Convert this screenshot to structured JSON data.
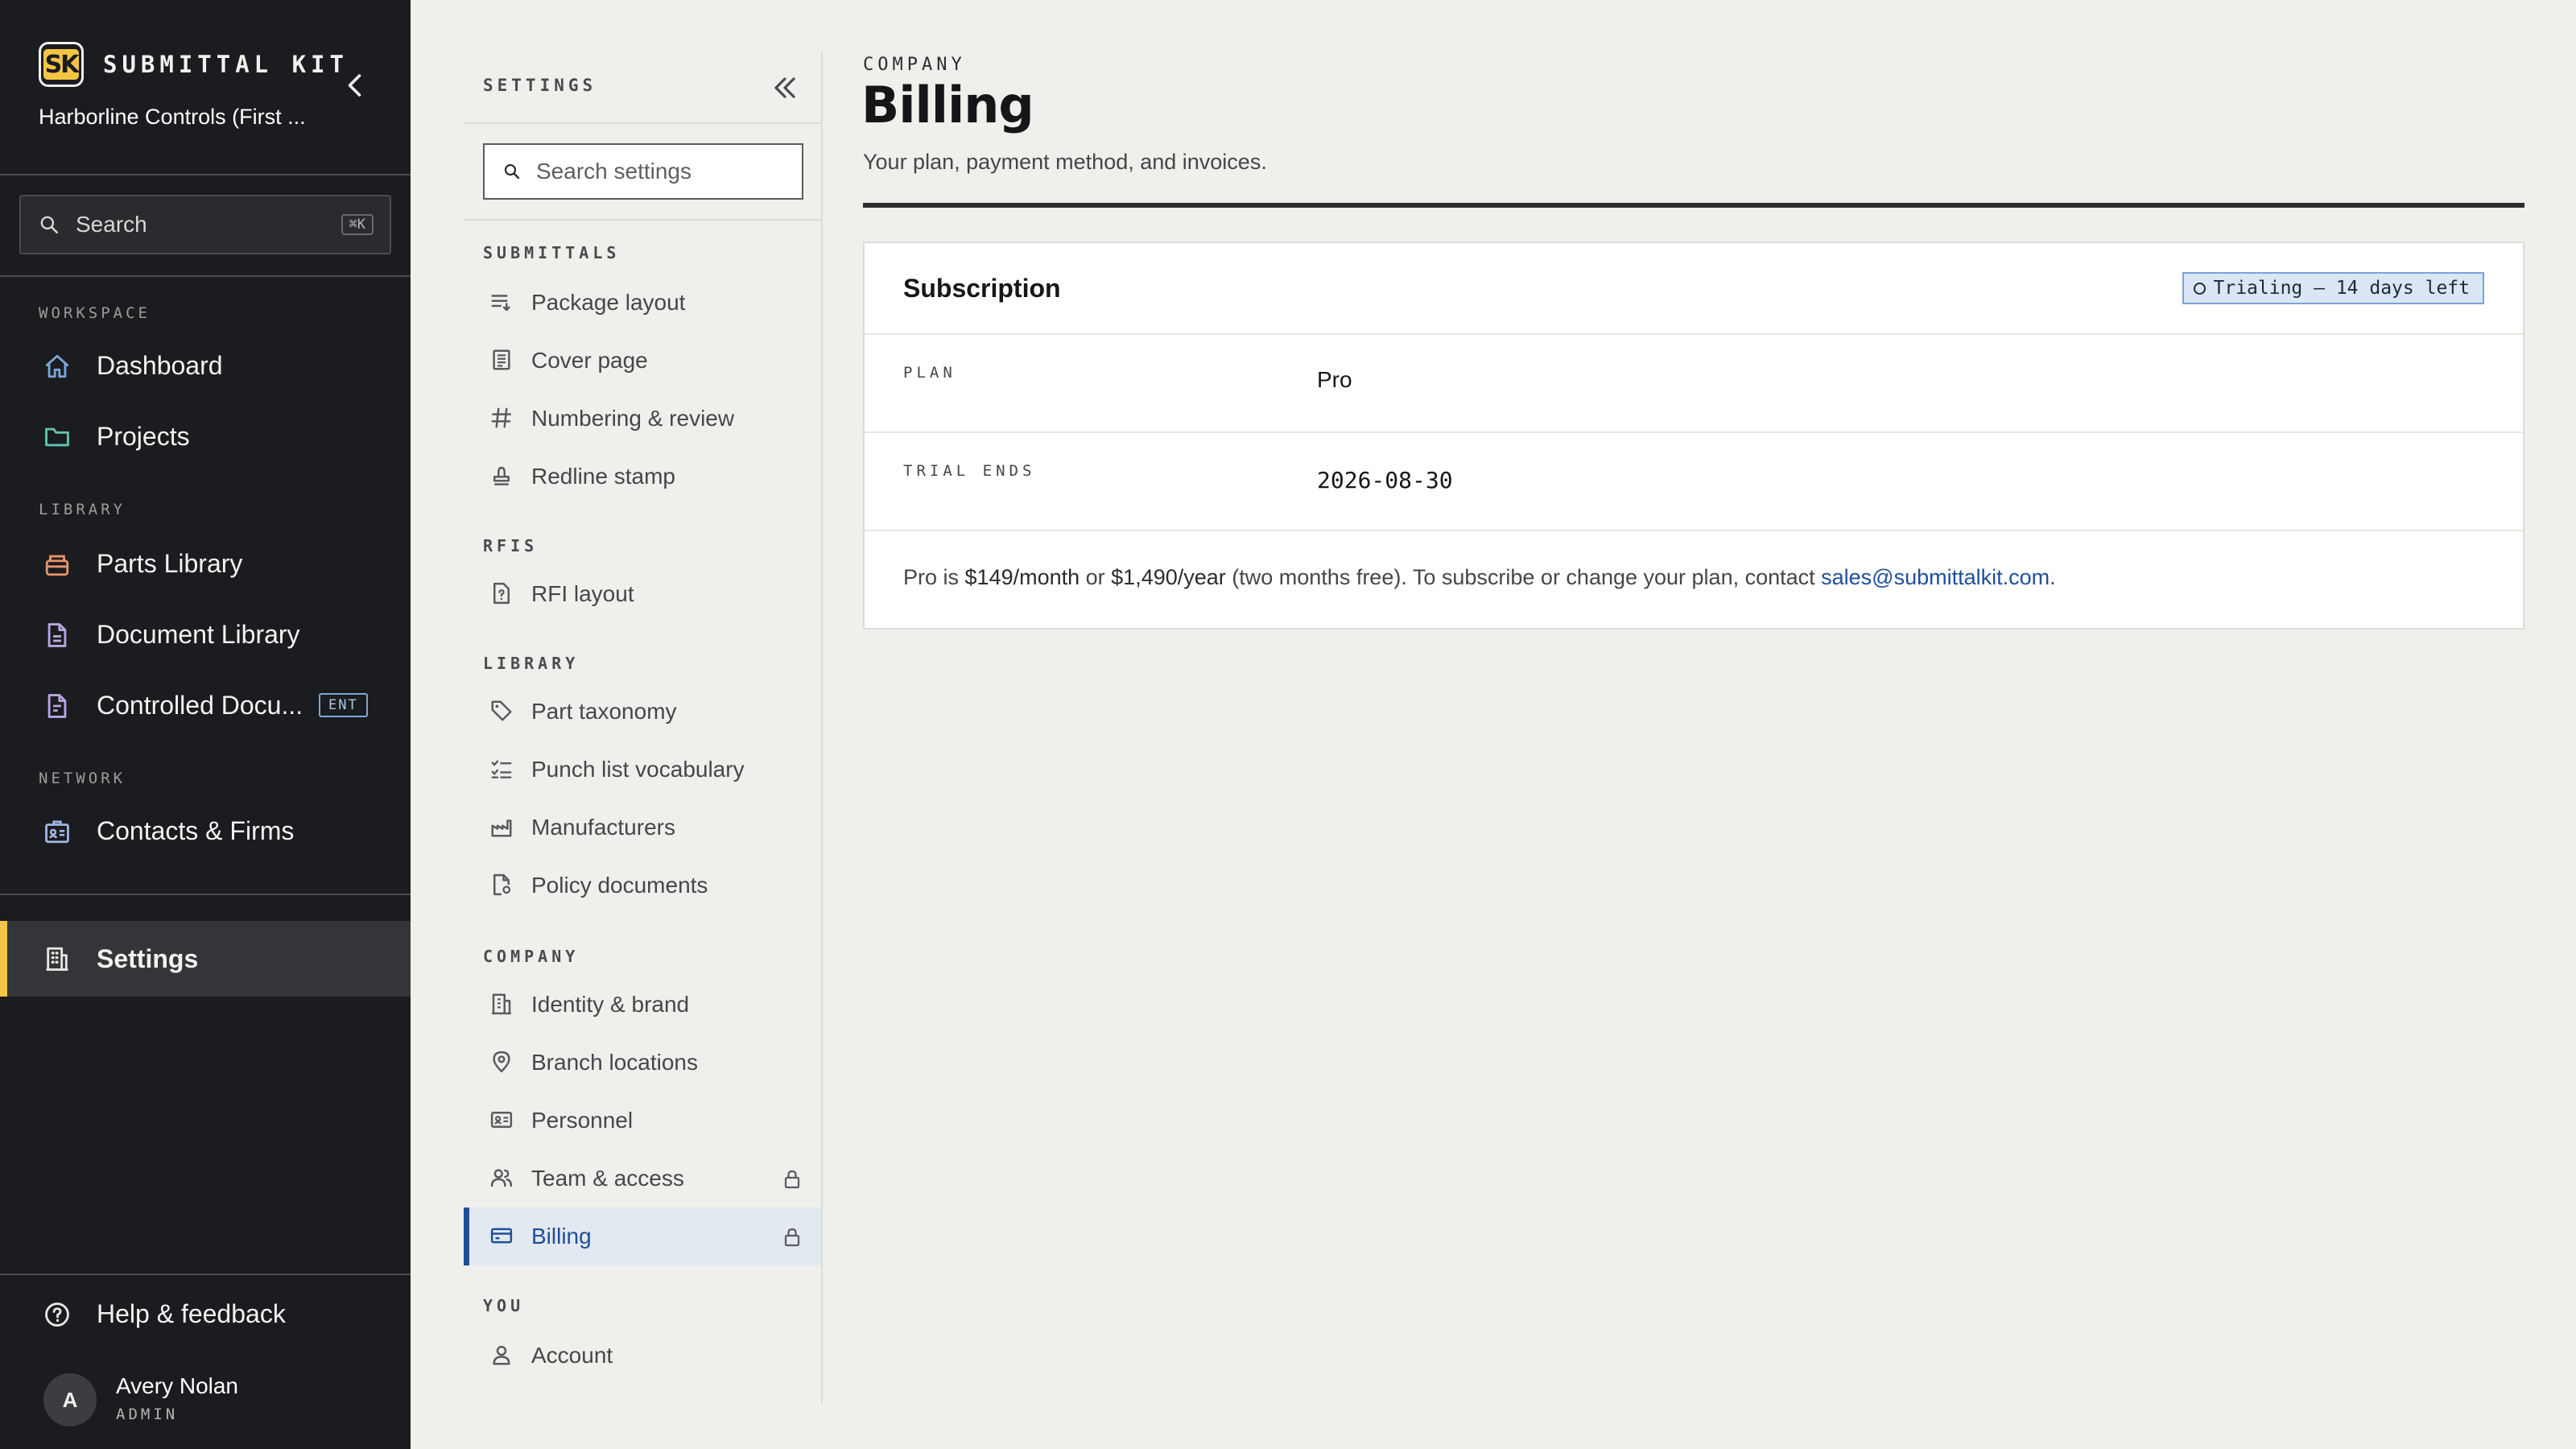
{
  "sidebar": {
    "logo_text": "SK",
    "brand": "SUBMITTAL KIT",
    "company": "Harborline Controls (First ...",
    "search": {
      "label": "Search",
      "shortcut": "⌘K"
    },
    "sections": {
      "workspace": "WORKSPACE",
      "library": "LIBRARY",
      "network": "NETWORK"
    },
    "items": {
      "dashboard": "Dashboard",
      "projects": "Projects",
      "parts_library": "Parts Library",
      "document_library": "Document Library",
      "controlled_docs": "Controlled Docu...",
      "controlled_docs_badge": "ENT",
      "contacts": "Contacts & Firms",
      "settings": "Settings",
      "help": "Help & feedback"
    },
    "user": {
      "initial": "A",
      "name": "Avery Nolan",
      "role": "ADMIN"
    },
    "icon_colors": {
      "dashboard": "#7aa7d8",
      "projects": "#5fc4b0",
      "parts": "#e8946a",
      "documents": "#b8a6e0",
      "contacts": "#9fb6e6",
      "accent": "#f4c542"
    }
  },
  "settings_nav": {
    "title": "SETTINGS",
    "search_placeholder": "Search settings",
    "sections": {
      "submittals": "SUBMITTALS",
      "rfis": "RFIS",
      "library": "LIBRARY",
      "company": "COMPANY",
      "you": "YOU"
    },
    "items": {
      "package_layout": "Package layout",
      "cover_page": "Cover page",
      "numbering_review": "Numbering & review",
      "redline_stamp": "Redline stamp",
      "rfi_layout": "RFI layout",
      "part_taxonomy": "Part taxonomy",
      "punch_list": "Punch list vocabulary",
      "manufacturers": "Manufacturers",
      "policy_documents": "Policy documents",
      "identity_brand": "Identity & brand",
      "branch_locations": "Branch locations",
      "personnel": "Personnel",
      "team_access": "Team & access",
      "billing": "Billing",
      "account": "Account"
    },
    "active_color": "#1e4f9a"
  },
  "main": {
    "breadcrumb": "COMPANY",
    "title": "Billing",
    "subtitle": "Your plan, payment method, and invoices.",
    "subscription": {
      "title": "Subscription",
      "badge": "Trialing — 14 days left",
      "plan_label": "PLAN",
      "plan_value": "Pro",
      "trial_label": "TRIAL ENDS",
      "trial_value": "2026-08-30",
      "note_prefix": "Pro is ",
      "monthly": "$149/month",
      "note_or": " or ",
      "yearly": "$1,490/year",
      "note_suffix": " (two months free). To subscribe or change your plan, contact ",
      "email": "sales@submittalkit.com",
      "note_end": "."
    }
  }
}
